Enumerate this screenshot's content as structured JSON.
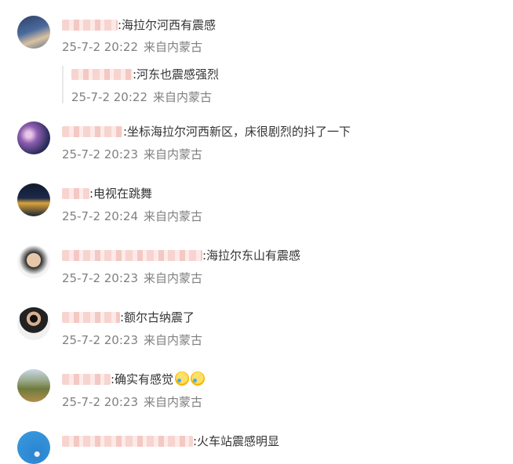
{
  "comments": [
    {
      "text": ":海拉尔河西有震感",
      "date": "25-7-2 20:22",
      "source": "来自内蒙古",
      "reply": {
        "text": ":河东也震感强烈",
        "date": "25-7-2 20:22",
        "source": "来自内蒙古"
      }
    },
    {
      "text": ":坐标海拉尔河西新区，床很剧烈的抖了一下",
      "date": "25-7-2 20:23",
      "source": "来自内蒙古"
    },
    {
      "text": ":电视在跳舞",
      "date": "25-7-2 20:24",
      "source": "来自内蒙古"
    },
    {
      "text": ":海拉尔东山有震感",
      "date": "25-7-2 20:23",
      "source": "来自内蒙古"
    },
    {
      "text": ":额尔古纳震了",
      "date": "25-7-2 20:23",
      "source": "来自内蒙古"
    },
    {
      "text": ":确实有感觉",
      "date": "25-7-2 20:23",
      "source": "来自内蒙古",
      "emojis": [
        "crying-laughing",
        "crying-laughing"
      ]
    },
    {
      "text": ":火车站震感明显"
    }
  ],
  "colors": {
    "meta": "#808080",
    "text": "#333333"
  }
}
